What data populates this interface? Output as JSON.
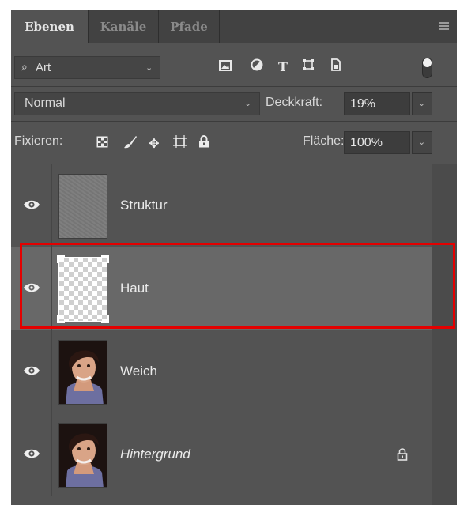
{
  "tabs": [
    {
      "label": "Ebenen",
      "active": true
    },
    {
      "label": "Kanäle",
      "active": false
    },
    {
      "label": "Pfade",
      "active": false
    }
  ],
  "filter": {
    "kind": "Art",
    "icons": [
      "image-filter-icon",
      "adjustment-filter-icon",
      "type-filter-icon",
      "shape-filter-icon",
      "smart-object-filter-icon"
    ]
  },
  "blend": {
    "mode": "Normal",
    "opacity_label": "Deckkraft:",
    "opacity_value": "19%"
  },
  "lock": {
    "label": "Fixieren:",
    "fill_label": "Fläche:",
    "fill_value": "100%"
  },
  "layers": [
    {
      "name": "Struktur",
      "visible": true,
      "selected": false,
      "thumbnail": "texture",
      "locked": false,
      "italic": false
    },
    {
      "name": "Haut",
      "visible": true,
      "selected": true,
      "thumbnail": "transparent",
      "locked": false,
      "italic": false
    },
    {
      "name": "Weich",
      "visible": true,
      "selected": false,
      "thumbnail": "portrait",
      "locked": false,
      "italic": false
    },
    {
      "name": "Hintergrund",
      "visible": true,
      "selected": false,
      "thumbnail": "portrait",
      "locked": true,
      "italic": true
    }
  ],
  "colors": {
    "panel": "#535353",
    "selected_row": "#686868",
    "highlight": "#e30000"
  }
}
